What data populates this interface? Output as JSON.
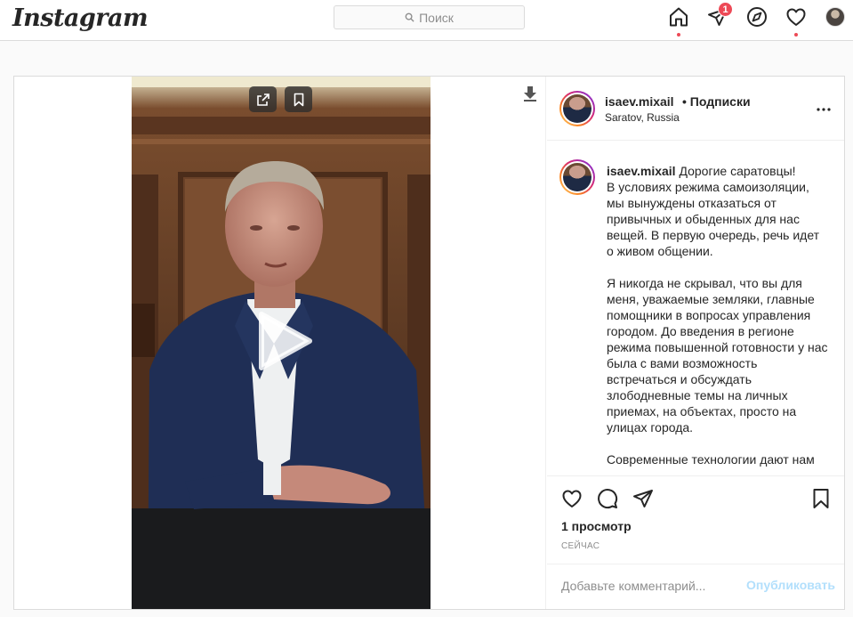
{
  "header": {
    "logo": "Instagram",
    "search_placeholder": "Поиск",
    "icons": [
      "home-icon",
      "direct-icon",
      "explore-icon",
      "activity-icon",
      "profile-avatar"
    ],
    "notification_count": "1"
  },
  "post": {
    "username": "isaev.mixail",
    "follow_separator": "•",
    "follow_label": "Подписки",
    "location": "Saratov, Russia",
    "caption": {
      "username": "isaev.mixail",
      "text": " Дорогие саратовцы!\nВ условиях режима самоизоляции, мы вынуждены отказаться от привычных и обыденных для нас вещей. В первую очередь, речь идет о живом общении.\n\nЯ никогда не скрывал, что вы для меня, уважаемые земляки, главные помощники в вопросах управления городом. До введения в регионе режима повышенной готовности у нас была с вами возможность встречаться и обсуждать злободневные темы на личных приемах, на объектах, просто на улицах города.\n\nСовременные технологии дают нам"
    },
    "views": "1 просмотр",
    "time": "СЕЙЧАС",
    "comment_placeholder": "Добавьте комментарий...",
    "publish_label": "Опубликовать"
  },
  "colors": {
    "accent": "#0095f6",
    "publish_disabled": "#b2dffc",
    "badge": "#ed4956",
    "border": "#dbdbdb"
  }
}
